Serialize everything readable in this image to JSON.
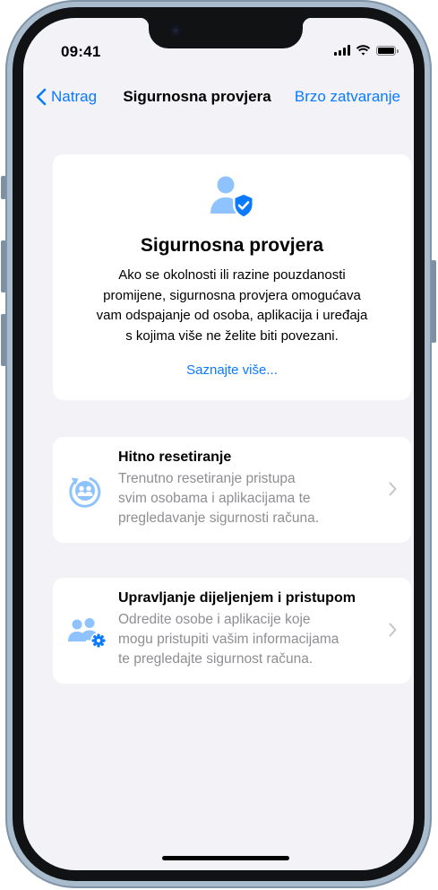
{
  "status_bar": {
    "time": "09:41"
  },
  "nav": {
    "back_label": "Natrag",
    "title": "Sigurnosna provjera",
    "action_label": "Brzo zatvaranje"
  },
  "hero": {
    "icon": "person-shield-icon",
    "title": "Sigurnosna provjera",
    "body_lines": [
      "Ako se okolnosti ili razine pouzdanosti",
      "promijene, sigurnosna provjera omogućava",
      "vam odspajanje od osoba, aplikacija i uređaja",
      "s kojima više ne želite biti povezani."
    ],
    "link_label": "Saznajte više..."
  },
  "options": [
    {
      "icon": "emergency-reset-icon",
      "title": "Hitno resetiranje",
      "description_lines": [
        "Trenutno resetiranje pristupa",
        "svim osobama i aplikacijama te",
        "pregledavanje sigurnosti računa."
      ]
    },
    {
      "icon": "manage-sharing-icon",
      "title": "Upravljanje dijeljenjem i pristupom",
      "description_lines": [
        "Odredite osobe i aplikacije koje",
        "mogu pristupiti vašim informacijama",
        "te pregledajte sigurnost računa."
      ]
    }
  ],
  "colors": {
    "accent": "#0a7aff",
    "icon_light": "#8fc3ff",
    "background": "#f2f2f7",
    "secondary_text": "#8e8e93",
    "frame": "#a9bccd"
  }
}
